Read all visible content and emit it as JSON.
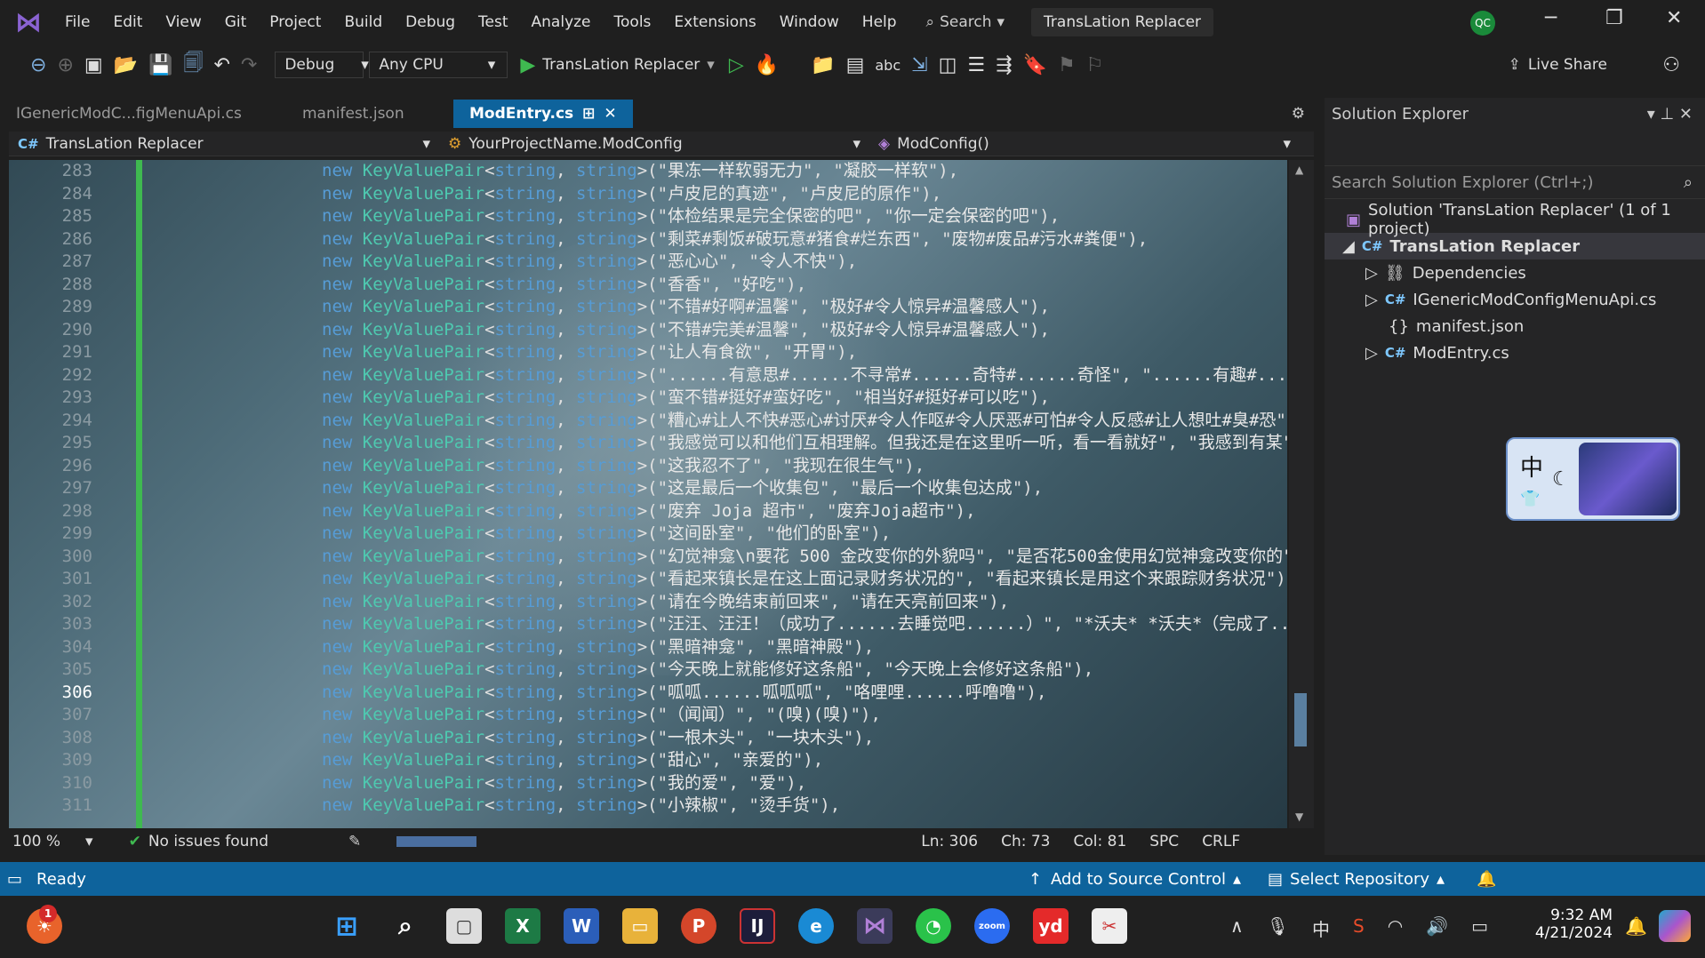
{
  "menu": {
    "items": [
      "File",
      "Edit",
      "View",
      "Git",
      "Project",
      "Build",
      "Debug",
      "Test",
      "Analyze",
      "Tools",
      "Extensions",
      "Window",
      "Help"
    ],
    "search": "Search",
    "title": "TransLation Replacer",
    "avatar": "QC"
  },
  "toolbar": {
    "config": "Debug",
    "platform": "Any CPU",
    "run_target": "TransLation Replacer",
    "live_share": "Live Share"
  },
  "tabs": [
    {
      "label": "IGenericModC...figMenuApi.cs"
    },
    {
      "label": "manifest.json"
    },
    {
      "label": "ModEntry.cs"
    }
  ],
  "navbar": {
    "project": "TransLation Replacer",
    "class": "YourProjectName.ModConfig",
    "member": "ModConfig()"
  },
  "code": {
    "lines": [
      {
        "n": "283",
        "a": "果冻一样软弱无力",
        "b": "凝胶一样软"
      },
      {
        "n": "284",
        "a": "卢皮尼的真迹",
        "b": "卢皮尼的原作"
      },
      {
        "n": "285",
        "a": "体检结果是完全保密的吧",
        "b": "你一定会保密的吧"
      },
      {
        "n": "286",
        "a": "剩菜#剩饭#破玩意#猪食#烂东西",
        "b": "废物#废品#污水#粪便"
      },
      {
        "n": "287",
        "a": "恶心心",
        "b": "令人不快"
      },
      {
        "n": "288",
        "a": "香香",
        "b": "好吃"
      },
      {
        "n": "289",
        "a": "不错#好啊#温馨",
        "b": "极好#令人惊异#温馨感人"
      },
      {
        "n": "290",
        "a": "不错#完美#温馨",
        "b": "极好#令人惊异#温馨感人"
      },
      {
        "n": "291",
        "a": "让人有食欲",
        "b": "开胃"
      },
      {
        "n": "292",
        "a": "......有意思#......不寻常#......奇特#......奇怪",
        "b": "......有趣#......不平常#......不同的#......非传统"
      },
      {
        "n": "293",
        "a": "蛮不错#挺好#蛮好吃",
        "b": "相当好#挺好#可以吃"
      },
      {
        "n": "294",
        "a": "糟心#让人不快#恶心#讨厌#令人作呕#令人厌恶#可怕#令人反感#让人想吐#臭#恐",
        "b": ""
      },
      {
        "n": "295",
        "a": "我感觉可以和他们互相理解。但我还是在这里听一听，看一看就好",
        "b": "我感到有某"
      },
      {
        "n": "296",
        "a": "这我忍不了",
        "b": "我现在很生气"
      },
      {
        "n": "297",
        "a": "这是最后一个收集包",
        "b": "最后一个收集包达成"
      },
      {
        "n": "298",
        "a": "废弃 Joja 超市",
        "b": "废弃Joja超市"
      },
      {
        "n": "299",
        "a": "这间卧室",
        "b": "他们的卧室"
      },
      {
        "n": "300",
        "a": "幻觉神龛\\n要花 500 金改变你的外貌吗",
        "b": "是否花500金使用幻觉神龛改变你的"
      },
      {
        "n": "301",
        "a": "看起来镇长是在这上面记录财务状况的",
        "b": "看起来镇长是用这个来跟踪财务状况"
      },
      {
        "n": "302",
        "a": "请在今晚结束前回来",
        "b": "请在天亮前回来"
      },
      {
        "n": "303",
        "a": "汪汪、汪汪！（成功了......去睡觉吧......）",
        "b": "*沃夫* *沃夫*（完成了...现在去睡"
      },
      {
        "n": "304",
        "a": "黑暗神龛",
        "b": "黑暗神殿"
      },
      {
        "n": "305",
        "a": "今天晚上就能修好这条船",
        "b": "今天晚上会修好这条船"
      },
      {
        "n": "306",
        "a": "呱呱......呱呱呱",
        "b": "咯哩哩......呼噜噜"
      },
      {
        "n": "307",
        "a": "（闻闻）",
        "b": "(嗅)(嗅)"
      },
      {
        "n": "308",
        "a": "一根木头",
        "b": "一块木头"
      },
      {
        "n": "309",
        "a": "甜心",
        "b": "亲爱的"
      },
      {
        "n": "310",
        "a": "我的爱",
        "b": "爱"
      },
      {
        "n": "311",
        "a": "小辣椒",
        "b": "烫手货"
      }
    ],
    "kw_new": "new",
    "type_kvp": "KeyValuePair",
    "type_string": "string"
  },
  "editor_status": {
    "zoom": "100 %",
    "issues": "No issues found",
    "ln": "Ln: 306",
    "ch": "Ch: 73",
    "col": "Col: 81",
    "spc": "SPC",
    "crlf": "CRLF"
  },
  "solution": {
    "title": "Solution Explorer",
    "search": "Search Solution Explorer (Ctrl+;)",
    "solution": "Solution 'TransLation Replacer' (1 of 1 project)",
    "project": "TransLation Replacer",
    "items": [
      "Dependencies",
      "IGenericModConfigMenuApi.cs",
      "manifest.json",
      "ModEntry.cs"
    ]
  },
  "ime": {
    "label": "中"
  },
  "status": {
    "ready": "Ready",
    "source": "Add to Source Control",
    "repo": "Select Repository"
  },
  "taskbar": {
    "time": "9:32 AM",
    "date": "4/21/2024",
    "badge": "1"
  }
}
